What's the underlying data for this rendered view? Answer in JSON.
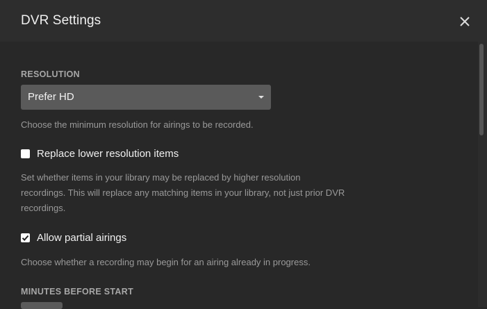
{
  "dialog": {
    "title": "DVR Settings",
    "close_icon": "close-icon"
  },
  "resolution": {
    "label": "RESOLUTION",
    "selected": "Prefer HD",
    "help": "Choose the minimum resolution for airings to be recorded."
  },
  "replace_lower": {
    "label": "Replace lower resolution items",
    "checked": false,
    "help": "Set whether items in your library may be replaced by higher resolution recordings. This will replace any matching items in your library, not just prior DVR recordings."
  },
  "partial_airings": {
    "label": "Allow partial airings",
    "checked": true,
    "help": "Choose whether a recording may begin for an airing already in progress."
  },
  "minutes_before": {
    "label": "MINUTES BEFORE START"
  },
  "colors": {
    "background": "#282828",
    "header": "#2d2d2d",
    "select": "#5a5a5a",
    "muted_text": "#9a9a9a"
  }
}
